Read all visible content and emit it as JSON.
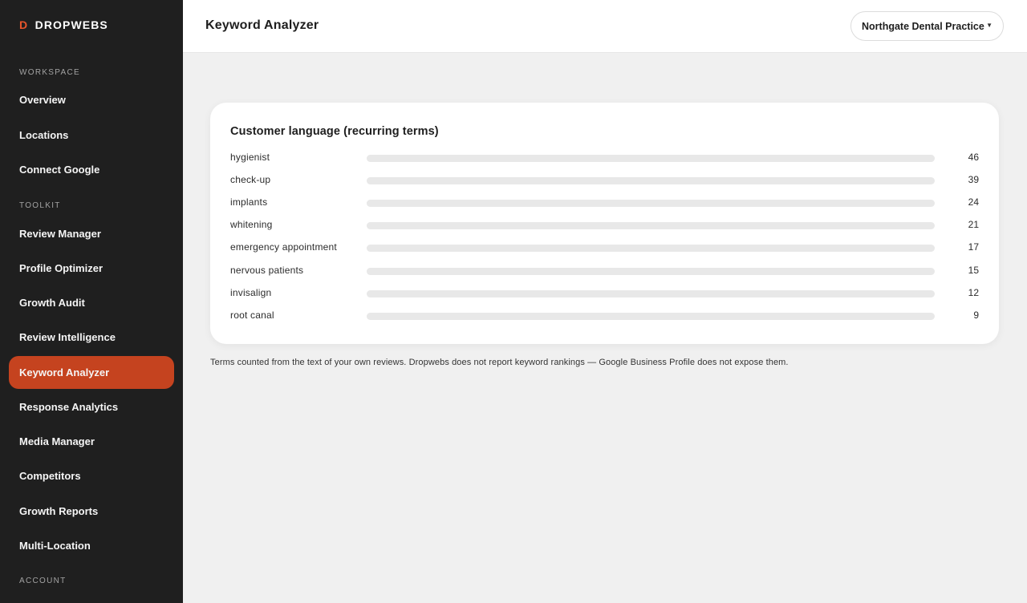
{
  "brand": {
    "mark": "D",
    "name": "DROPWEBS"
  },
  "sidebar": {
    "sections": [
      {
        "label": "WORKSPACE"
      },
      {
        "label": "TOOLKIT"
      },
      {
        "label": "ACCOUNT"
      }
    ],
    "items": [
      {
        "label": "Overview",
        "active": false
      },
      {
        "label": "Locations",
        "active": false
      },
      {
        "label": "Connect Google",
        "active": false
      },
      {
        "label": "Review Manager",
        "active": false
      },
      {
        "label": "Profile Optimizer",
        "active": false
      },
      {
        "label": "Growth Audit",
        "active": false
      },
      {
        "label": "Review Intelligence",
        "active": false
      },
      {
        "label": "Keyword Analyzer",
        "active": true
      },
      {
        "label": "Response Analytics",
        "active": false
      },
      {
        "label": "Media Manager",
        "active": false
      },
      {
        "label": "Competitors",
        "active": false
      },
      {
        "label": "Growth Reports",
        "active": false
      },
      {
        "label": "Multi-Location",
        "active": false
      }
    ]
  },
  "header": {
    "title": "Keyword Analyzer",
    "location_select": "Northgate Dental Practice",
    "caret": "▼"
  },
  "card": {
    "title": "Customer language (recurring terms)",
    "terms": [
      {
        "term": "hygienist",
        "count": "46"
      },
      {
        "term": "check-up",
        "count": "39"
      },
      {
        "term": "implants",
        "count": "24"
      },
      {
        "term": "whitening",
        "count": "21"
      },
      {
        "term": "emergency appointment",
        "count": "17"
      },
      {
        "term": "nervous patients",
        "count": "15"
      },
      {
        "term": "invisalign",
        "count": "12"
      },
      {
        "term": "root canal",
        "count": "9"
      }
    ]
  },
  "footnote": "Terms counted from the text of your own reviews. Dropwebs does not report keyword rankings — Google Business Profile does not expose them.",
  "colors": {
    "sidebar_bg": "#1f1f1f",
    "accent": "#c5431f",
    "brand_mark": "#e8552b",
    "track": "#e8e8e8"
  }
}
